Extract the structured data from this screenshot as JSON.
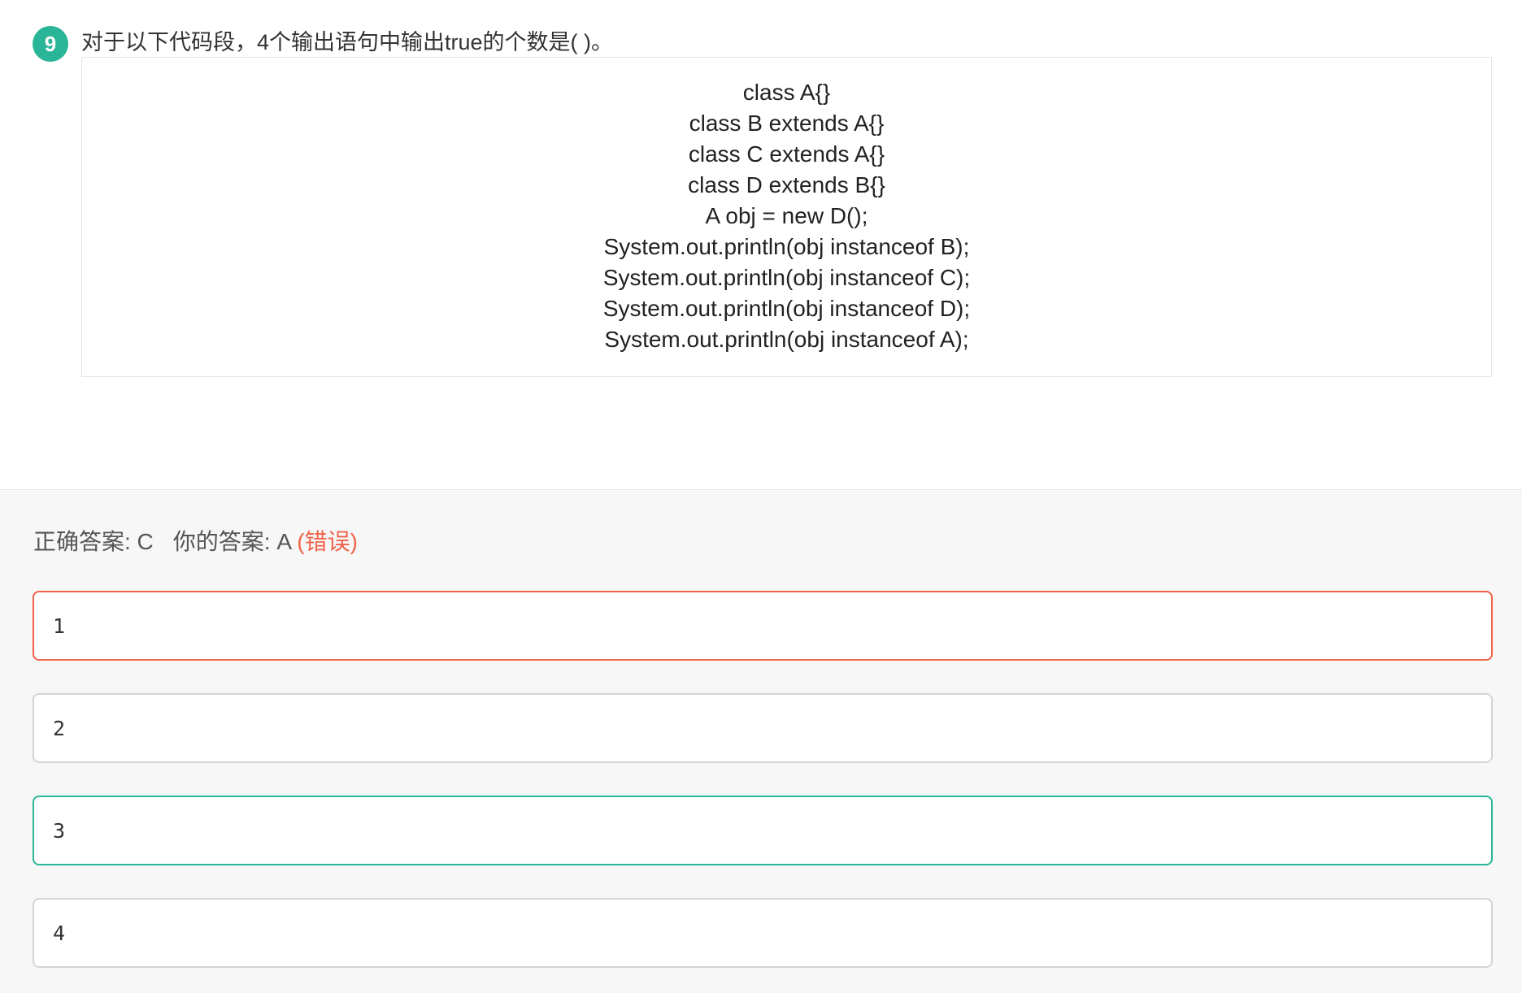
{
  "question": {
    "number": "9",
    "text": "对于以下代码段，4个输出语句中输出true的个数是(    )。",
    "code_lines": [
      "class A{}",
      "class B extends A{}",
      "class C extends A{}",
      "class D extends B{}",
      "A obj = new D();",
      "System.out.println(obj instanceof B);",
      "System.out.println(obj instanceof C);",
      "System.out.println(obj instanceof D);",
      "System.out.println(obj instanceof A);"
    ]
  },
  "result": {
    "correct_label": "正确答案: C",
    "your_label": "你的答案: A",
    "status": "(错误)"
  },
  "options": [
    {
      "label": "1",
      "state": "selected-wrong"
    },
    {
      "label": "2",
      "state": "normal"
    },
    {
      "label": "3",
      "state": "correct"
    },
    {
      "label": "4",
      "state": "normal"
    }
  ],
  "colors": {
    "accent_green": "#2bb598",
    "error_red": "#f0624a",
    "border_gray": "#d4d4d4",
    "panel_bg": "#f7f7f7"
  }
}
